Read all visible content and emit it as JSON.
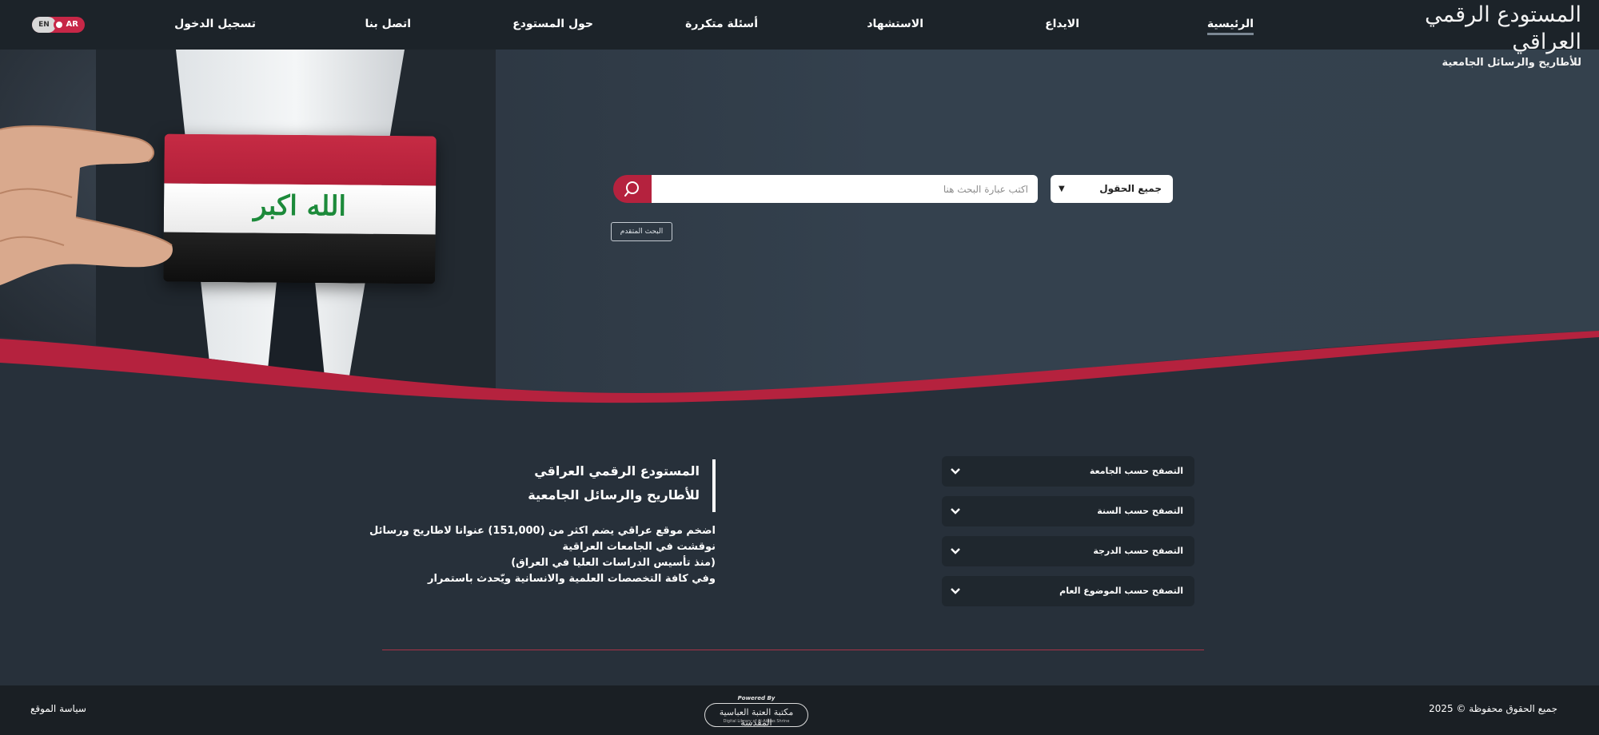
{
  "header": {
    "logo": {
      "line1": "المستودع الرقمي العراقي",
      "line2": "للأطاريح والرسائل الجامعية"
    },
    "nav": [
      {
        "label": "الرئيسية",
        "active": true
      },
      {
        "label": "الايداع"
      },
      {
        "label": "الاستشهاد"
      },
      {
        "label": "أسئلة متكررة"
      },
      {
        "label": "حول المستودع"
      },
      {
        "label": "اتصل بنا"
      },
      {
        "label": "تسجيل الدخول"
      }
    ],
    "language": {
      "en": "EN",
      "ar": "AR"
    }
  },
  "hero": {
    "flag_text": "الله اكبر"
  },
  "search": {
    "field_select": "جميع الحقول",
    "placeholder": "اكتب عبارة البحث هنا",
    "advanced_label": "البحث المتقدم"
  },
  "about": {
    "title_line1": "المستودع الرقمي العراقي",
    "title_line2": "للأطاريح والرسائل الجامعية",
    "desc_line1": "اضخم موقع عراقي يضم اكثر من (151,000) عنوانا لاطاريح ورسائل",
    "desc_line2": "نوقشت في الجامعات العراقية",
    "desc_line3": "(منذ تأسيس الدراسات العليا في العراق)",
    "desc_line4": "وفي كافة التخصصات العلمية والانسانية ويّحدث باستمرار"
  },
  "browse": [
    {
      "label": "التصفح حسب الجامعة"
    },
    {
      "label": "التصفح حسب السنة"
    },
    {
      "label": "التصفح حسب الدرجة"
    },
    {
      "label": "التصفح حسب الموضوع العام"
    }
  ],
  "footer": {
    "copyright": "جميع الحقوق محفوظة © 2025",
    "policy": "سياسة الموقع",
    "powered_label": "Powered By",
    "powered_name": "مكتبة العتبة العباسية المقدسة",
    "powered_sub": "Digital Library of Al-Abbas Shrine"
  },
  "colors": {
    "accent": "#b5223e",
    "nav_bg": "#1c2329",
    "body_bg": "#27303a",
    "footer_bg": "#1a1f24"
  }
}
